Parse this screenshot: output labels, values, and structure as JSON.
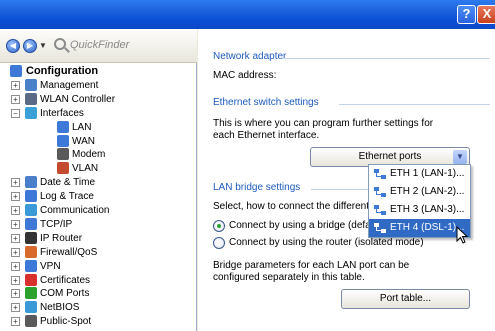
{
  "window": {
    "help_glyph": "?",
    "close_glyph": "X"
  },
  "nav": {
    "back_glyph": "◀",
    "forward_glyph": "▶",
    "dropdown_glyph": "▼",
    "quickfinder_placeholder": "QuickFinder"
  },
  "tree": {
    "root_label": "Configuration",
    "items": [
      {
        "label": "Management",
        "expander": "+",
        "icon": "management-icon",
        "color": "#4a7fc9"
      },
      {
        "label": "WLAN Controller",
        "expander": "+",
        "icon": "wlan-controller-icon",
        "color": "#5b6b86"
      },
      {
        "label": "Interfaces",
        "expander": "−",
        "icon": "interfaces-icon",
        "color": "#3aa0d8"
      },
      {
        "label": "LAN",
        "expander": "",
        "icon": "lan-icon",
        "color": "#3d79d8"
      },
      {
        "label": "WAN",
        "expander": "",
        "icon": "wan-icon",
        "color": "#3d79d8"
      },
      {
        "label": "Modem",
        "expander": "",
        "icon": "modem-icon",
        "color": "#5a5a5a"
      },
      {
        "label": "VLAN",
        "expander": "",
        "icon": "vlan-icon",
        "color": "#c44a2c"
      },
      {
        "label": "Date & Time",
        "expander": "+",
        "icon": "clock-icon",
        "color": "#4a7fc9"
      },
      {
        "label": "Log & Trace",
        "expander": "+",
        "icon": "log-icon",
        "color": "#3d79d8"
      },
      {
        "label": "Communication",
        "expander": "+",
        "icon": "communication-icon",
        "color": "#3a9ad8"
      },
      {
        "label": "TCP/IP",
        "expander": "+",
        "icon": "tcpip-icon",
        "color": "#3d79d8"
      },
      {
        "label": "IP Router",
        "expander": "+",
        "icon": "router-icon",
        "color": "#333333"
      },
      {
        "label": "Firewall/QoS",
        "expander": "+",
        "icon": "firewall-icon",
        "color": "#d86a2c"
      },
      {
        "label": "VPN",
        "expander": "+",
        "icon": "vpn-icon",
        "color": "#3d79d8"
      },
      {
        "label": "Certificates",
        "expander": "+",
        "icon": "certificate-icon",
        "color": "#d8302c"
      },
      {
        "label": "COM Ports",
        "expander": "+",
        "icon": "com-ports-icon",
        "color": "#2da12d"
      },
      {
        "label": "NetBIOS",
        "expander": "+",
        "icon": "netbios-icon",
        "color": "#3a9ad8"
      },
      {
        "label": "Public-Spot",
        "expander": "+",
        "icon": "public-spot-icon",
        "color": "#5a5a5a"
      }
    ]
  },
  "network_adapter": {
    "title": "Network adapter",
    "mac_label": "MAC address:"
  },
  "ethernet_switch": {
    "title": "Ethernet switch settings",
    "description": "This is where you can program further settings for each Ethernet interface.",
    "ports_button": "Ethernet ports",
    "dropdown_arrow": "▼",
    "port_options": [
      "ETH 1 (LAN-1)...",
      "ETH 2 (LAN-2)...",
      "ETH 3 (LAN-3)...",
      "ETH 4 (DSL-1)..."
    ],
    "selected_index": 3
  },
  "lan_bridge": {
    "title": "LAN bridge settings",
    "description": "Select, how to connect the different LA",
    "option_bridge": "Connect by using a bridge (default)",
    "option_router": "Connect by using the router (isolated mode)",
    "bridge_params": "Bridge parameters for each LAN port can be configured separately in this table.",
    "port_table_button": "Port table..."
  },
  "colors": {
    "accent": "#316ac5",
    "group_title": "#1d5bbf"
  }
}
